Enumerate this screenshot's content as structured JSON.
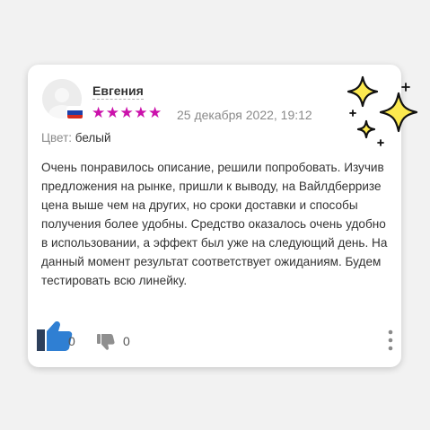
{
  "review": {
    "author": "Евгения",
    "rating": 5,
    "stars": "★★★★★",
    "date": "25 декабря 2022, 19:12",
    "color_label": "Цвет:",
    "color_value": "белый",
    "text": "Очень понравилось описание, решили попробовать. Изучив предложения на рынке, пришли к выводу, на Вайлдберризе цена выше чем на других, но сроки доставки и способы получения более удобны. Средство оказалось очень удобно в использовании, а эффект был уже на следующий день. На данный момент результат соответствует ожиданиям. Будем тестировать всю линейку.",
    "likes": "0",
    "dislikes": "0"
  },
  "colors": {
    "star": "#cb11ab",
    "like_blue": "#2f7fd3",
    "like_navy": "#2d3f5b",
    "sparkle_fill": "#fce94f",
    "sparkle_stroke": "#111111",
    "flag": [
      "#ffffff",
      "#1c3fa8",
      "#d52b1e"
    ]
  },
  "icons": {
    "avatar": "user-avatar-icon",
    "flag": "russia-flag-icon",
    "like": "thumbs-up-icon",
    "dislike": "thumbs-down-icon",
    "more": "more-vertical-icon",
    "decoration": "sparkles-icon"
  }
}
